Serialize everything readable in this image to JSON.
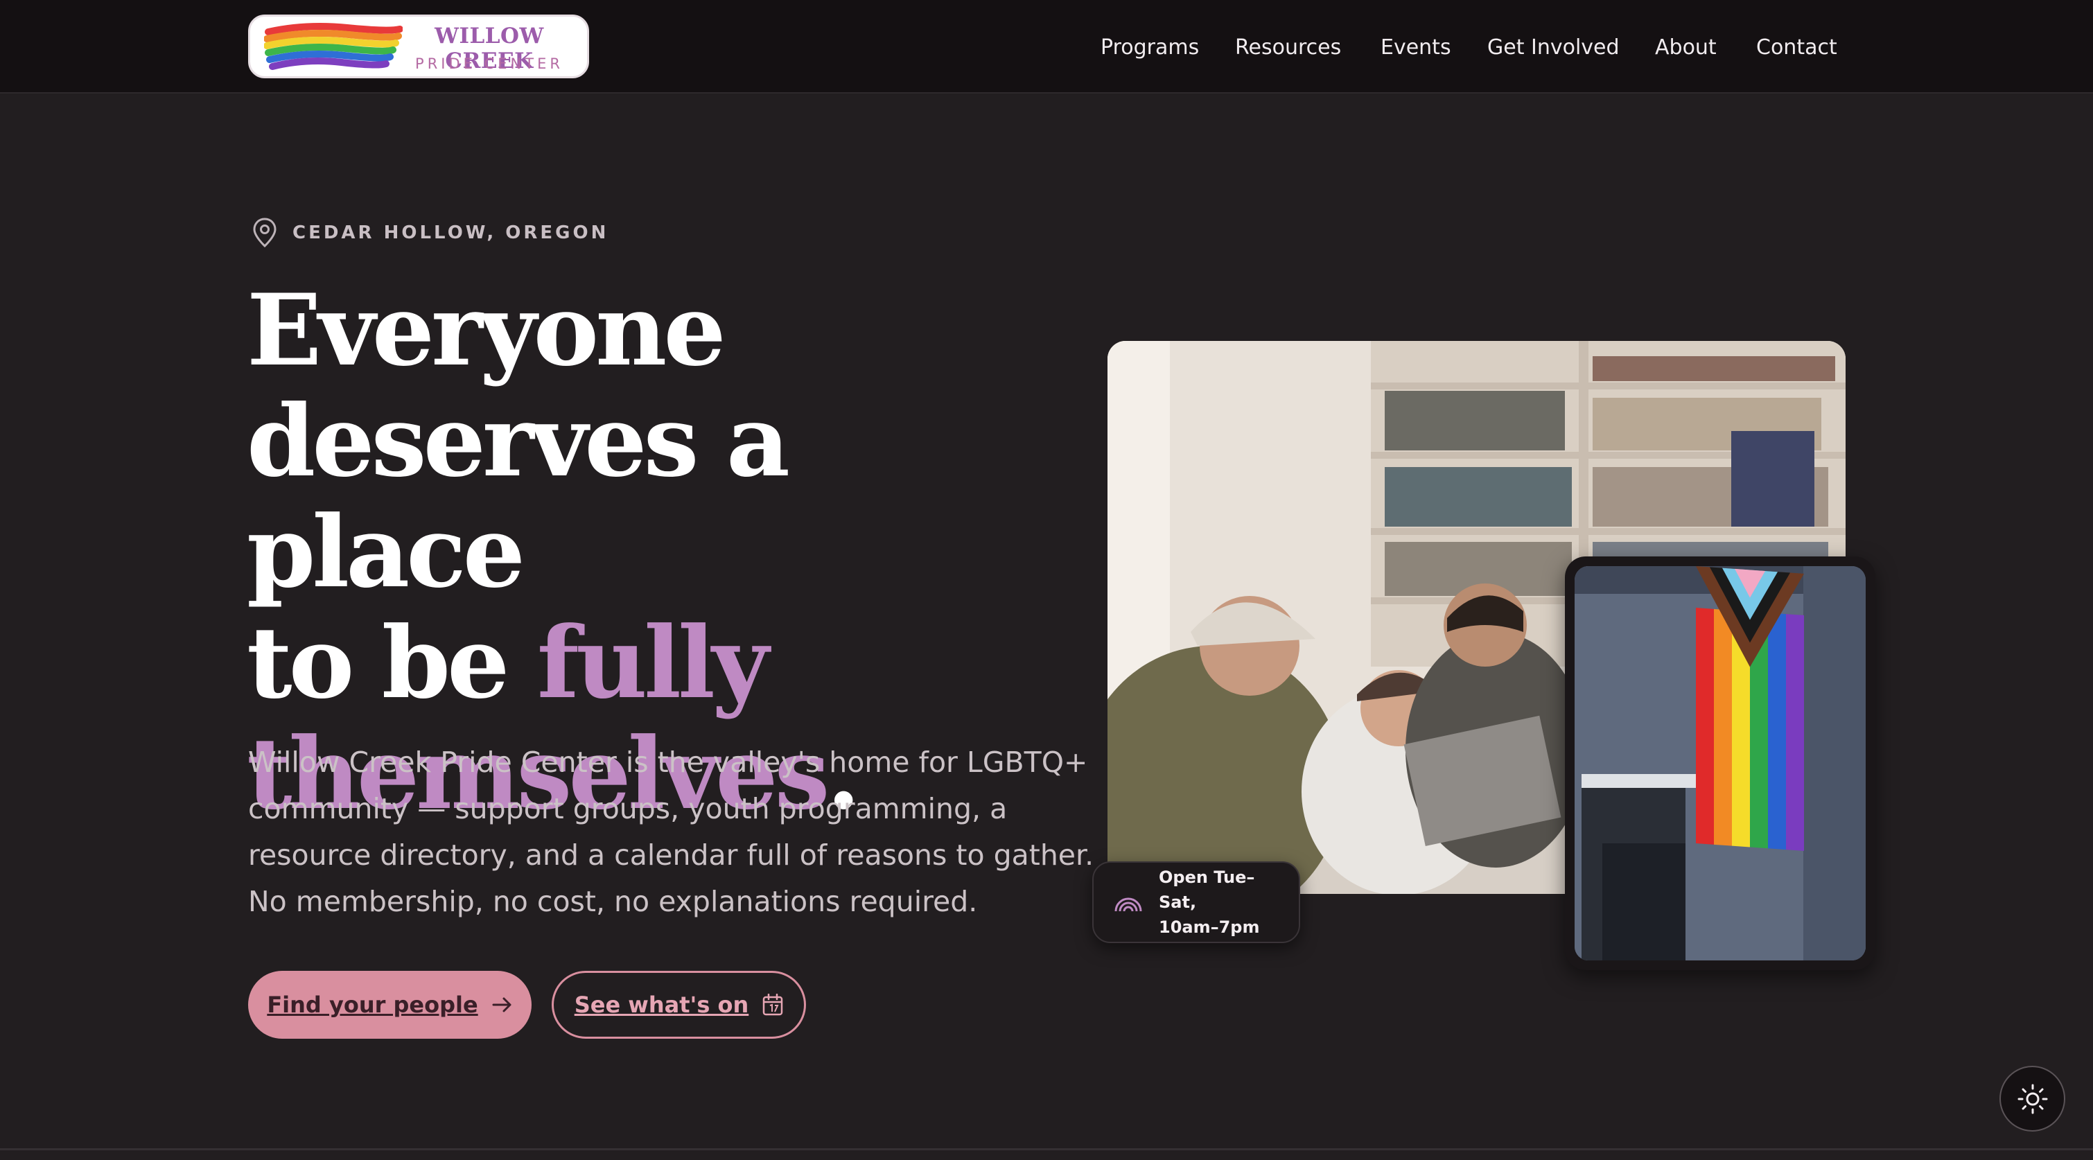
{
  "brand": {
    "name": "WILLOW CREEK",
    "subtitle": "PRIDE CENTER"
  },
  "nav": {
    "items": [
      "Programs",
      "Resources",
      "Events",
      "Get Involved",
      "About",
      "Contact"
    ]
  },
  "hero": {
    "location": "CEDAR HOLLOW, OREGON",
    "headline_line1": "Everyone",
    "headline_line2": "deserves a place",
    "headline_line3_plain": "to be ",
    "headline_line3_accent": "fully",
    "headline_line4_accent": "themselves",
    "headline_line4_plain": ".",
    "lede": "Willow Creek Pride Center is the valley's home for LGBTQ+ community — support groups, youth programming, a resource directory, and a calendar full of reasons to gather. No membership, no cost, no explanations required.",
    "primary_cta": "Find your people",
    "secondary_cta": "See what's on"
  },
  "hours_badge": {
    "line1": "Open Tue–Sat,",
    "line2": "10am–7pm"
  },
  "icons": {
    "location": "map-pin-icon",
    "primary_cta": "arrow-right-icon",
    "secondary_cta": "calendar-icon",
    "hours": "rainbow-icon",
    "theme": "sun-icon"
  },
  "colors": {
    "background": "#221e20",
    "header": "#141012",
    "accent_purple": "#bf8ac3",
    "accent_pink": "#d98f9f"
  }
}
